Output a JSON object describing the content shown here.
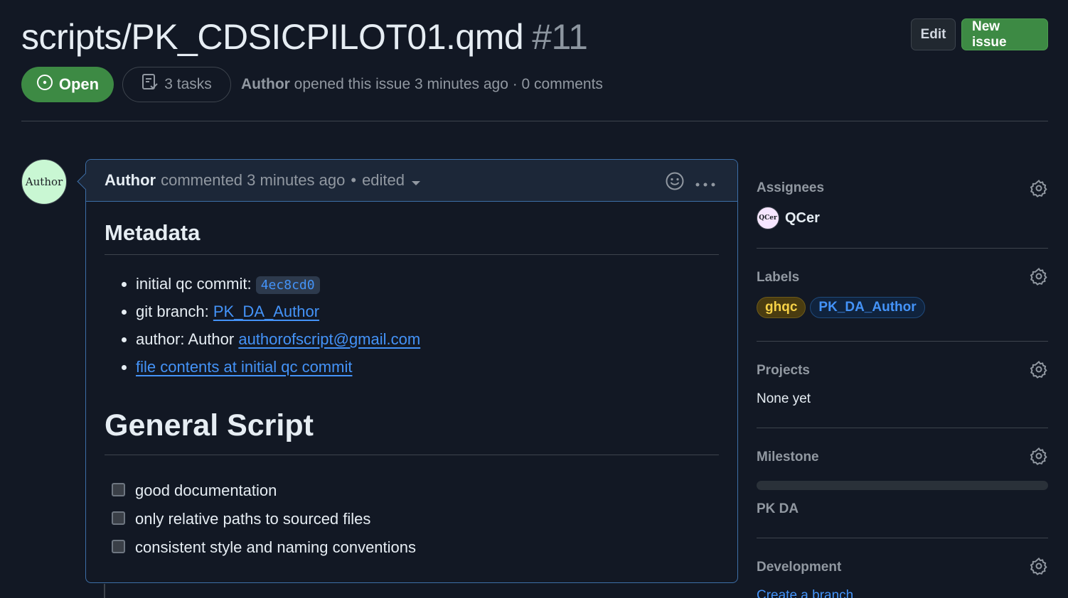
{
  "issue": {
    "title": "scripts/PK_CDSICPILOT01.qmd",
    "number": "#11",
    "state": "Open",
    "tasks": "3 tasks",
    "author": "Author",
    "opened_text": "opened this issue 3 minutes ago · 0 comments"
  },
  "header": {
    "edit_label": "Edit",
    "new_issue_label": "New issue"
  },
  "comment": {
    "avatar_text": "Author",
    "author": "Author",
    "meta": "commented 3 minutes ago",
    "edited": "edited",
    "body": {
      "metadata_heading": "Metadata",
      "metadata_items": [
        {
          "prefix": "initial qc commit: ",
          "code": "4ec8cd0"
        },
        {
          "prefix": "git branch: ",
          "link": "PK_DA_Author"
        },
        {
          "prefix": "author: Author ",
          "link": "authorofscript@gmail.com"
        },
        {
          "link": "file contents at initial qc commit"
        }
      ],
      "section_heading": "General Script",
      "checklist": [
        {
          "label": "good documentation",
          "checked": false
        },
        {
          "label": "only relative paths to sourced files",
          "checked": false
        },
        {
          "label": "consistent style and naming conventions",
          "checked": false
        }
      ]
    }
  },
  "sidebar": {
    "assignees": {
      "title": "Assignees",
      "avatar_text": "QCer",
      "name": "QCer"
    },
    "labels": {
      "title": "Labels",
      "items": [
        "ghqc",
        "PK_DA_Author"
      ]
    },
    "projects": {
      "title": "Projects",
      "value": "None yet"
    },
    "milestone": {
      "title": "Milestone",
      "progress": 0,
      "name": "PK DA"
    },
    "development": {
      "title": "Development",
      "link": "Create a branch"
    }
  },
  "colors": {
    "open_green": "#3d8a44",
    "link_blue": "#4493f8",
    "background": "#121824",
    "border": "#3d444d"
  },
  "icons": [
    "issue-opened-icon",
    "tasklist-icon",
    "smiley-icon",
    "kebab-horizontal-icon",
    "gear-icon",
    "triangle-down-icon"
  ]
}
